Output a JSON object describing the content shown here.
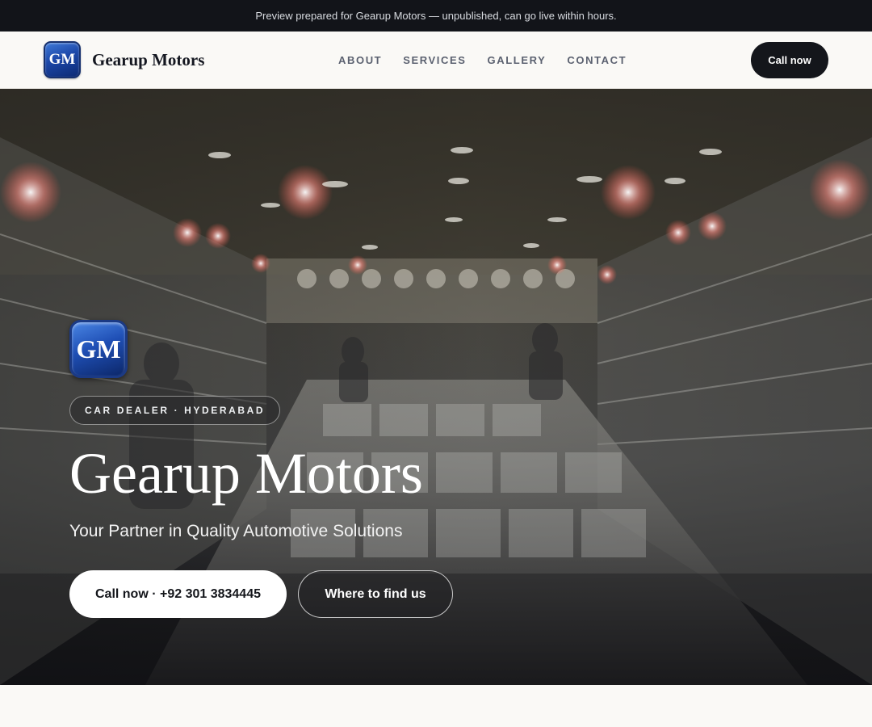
{
  "preview_banner": "Preview prepared for Gearup Motors — unpublished, can go live within hours.",
  "header": {
    "logo_initials": "GM",
    "brand_name": "Gearup Motors",
    "nav": [
      "ABOUT",
      "SERVICES",
      "GALLERY",
      "CONTACT"
    ],
    "call_label": "Call now"
  },
  "hero": {
    "logo_initials": "GM",
    "tag": "CAR DEALER · HYDERABAD",
    "title": "Gearup Motors",
    "subtitle": "Your Partner in Quality Automotive Solutions",
    "primary_cta": "Call now · +92 301 3834445",
    "secondary_cta": "Where to find us"
  },
  "colors": {
    "topbar_bg": "#121419",
    "dark_button": "#14161b",
    "logo_blue": "#1c47a8",
    "page_bg": "#faf9f6"
  }
}
